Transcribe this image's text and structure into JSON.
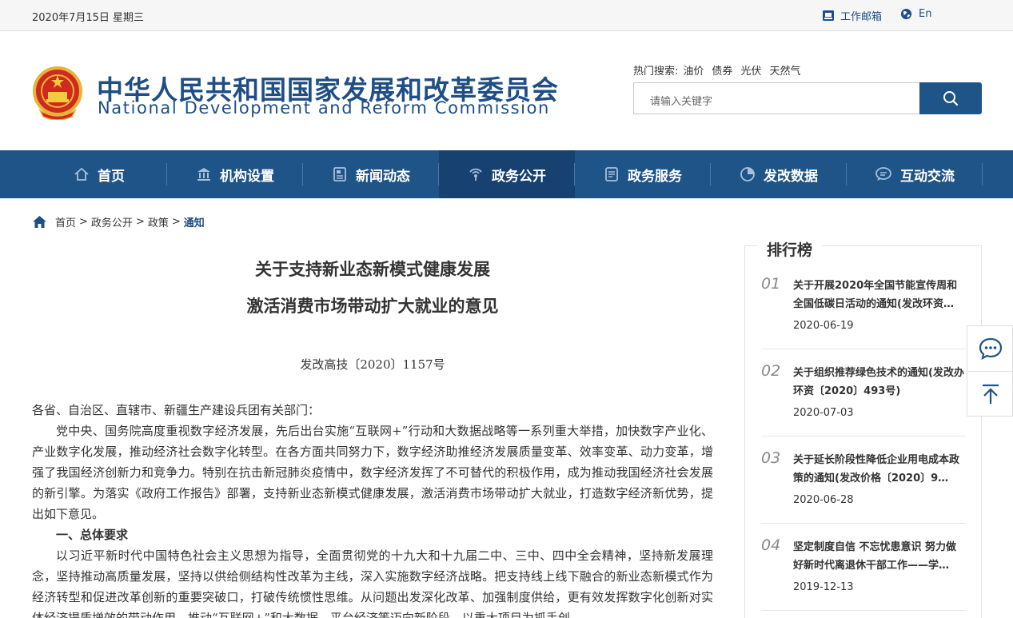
{
  "topbar": {
    "date": "2020年7月15日 星期三",
    "mail_label": "工作邮箱",
    "lang_label": "En"
  },
  "header": {
    "org_name_cn": "中华人民共和国国家发展和改革委员会",
    "org_name_en": "National Development and Reform Commission",
    "hot_search_label": "热门搜索:",
    "hot_terms": [
      "油价",
      "债券",
      "光伏",
      "天然气"
    ],
    "search_placeholder": "请输入关键字"
  },
  "nav": {
    "items": [
      {
        "label": "首页",
        "icon": "home-icon"
      },
      {
        "label": "机构设置",
        "icon": "institution-icon"
      },
      {
        "label": "新闻动态",
        "icon": "news-icon"
      },
      {
        "label": "政务公开",
        "icon": "broadcast-icon"
      },
      {
        "label": "政务服务",
        "icon": "document-icon"
      },
      {
        "label": "发改数据",
        "icon": "pie-chart-icon"
      },
      {
        "label": "互动交流",
        "icon": "chat-icon"
      }
    ],
    "active_index": 3
  },
  "breadcrumb": {
    "items": [
      "首页",
      "政务公开",
      "政策"
    ],
    "current": "通知",
    "separator": ">"
  },
  "article": {
    "title_line1": "关于支持新业态新模式健康发展",
    "title_line2": "激活消费市场带动扩大就业的意见",
    "doc_number": "发改高技〔2020〕1157号",
    "recipients": "各省、自治区、直辖市、新疆生产建设兵团有关部门：",
    "para1": "党中央、国务院高度重视数字经济发展，先后出台实施“互联网+”行动和大数据战略等一系列重大举措，加快数字产业化、产业数字化发展，推动经济社会数字化转型。在各方面共同努力下，数字经济助推经济发展质量变革、效率变革、动力变革，增强了我国经济创新力和竞争力。特别在抗击新冠肺炎疫情中，数字经济发挥了不可替代的积极作用，成为推动我国经济社会发展的新引擎。为落实《政府工作报告》部署，支持新业态新模式健康发展，激活消费市场带动扩大就业，打造数字经济新优势，提出如下意见。",
    "section1_heading": "一、总体要求",
    "para2": "以习近平新时代中国特色社会主义思想为指导，全面贯彻党的十九大和十九届二中、三中、四中全会精神，坚持新发展理念，坚持推动高质量发展，坚持以供给侧结构性改革为主线，深入实施数字经济战略。把支持线上线下融合的新业态新模式作为经济转型和促进改革创新的重要突破口，打破传统惯性思维。从问题出发深化改革、加强制度供给，更有效发挥数字化创新对实体经济提质增效的带动作用，推动“互联网+”和大数据、平台经济等迈向新阶段。以重大项目为抓手创"
  },
  "ranking": {
    "title": "排行榜",
    "items": [
      {
        "num": "01",
        "title": "关于开展2020年全国节能宣传周和全国低碳日活动的通知(发改环资…",
        "date": "2020-06-19"
      },
      {
        "num": "02",
        "title": "关于组织推荐绿色技术的通知(发改办环资〔2020〕493号)",
        "date": "2020-07-03"
      },
      {
        "num": "03",
        "title": "关于延长阶段性降低企业用电成本政策的通知(发改价格〔2020〕9…",
        "date": "2020-06-28"
      },
      {
        "num": "04",
        "title": "坚定制度自信 不忘忧患意识 努力做好新时代离退休干部工作——学…",
        "date": "2019-12-13"
      }
    ]
  },
  "floating": {
    "chat_icon": "chat-bubble-icon",
    "top_icon": "back-to-top-icon"
  },
  "colors": {
    "brand_blue": "#1e5488",
    "nav_active": "#164170"
  }
}
